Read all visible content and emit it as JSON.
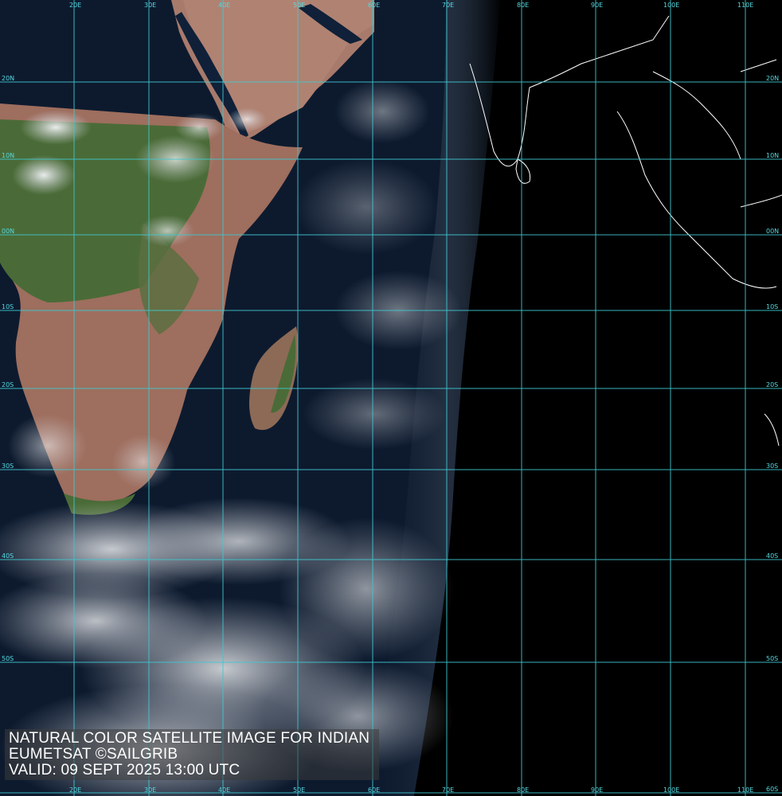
{
  "caption": {
    "line1": "NATURAL COLOR SATELLITE IMAGE FOR INDIAN",
    "line2": "EUMETSAT ©SAILGRIB",
    "line3": "VALID:  09 SEPT 2025 13:00 UTC"
  },
  "grid": {
    "lon_labels": [
      "20E",
      "30E",
      "40E",
      "50E",
      "60E",
      "70E",
      "80E",
      "90E",
      "100E",
      "110E"
    ],
    "lat_labels": [
      "20N",
      "10N",
      "00N",
      "10S",
      "20S",
      "30S",
      "40S",
      "50S",
      "60S"
    ],
    "line_color": "#3fc8d0"
  },
  "colors": {
    "ocean": "#0d1a2e",
    "night": "#000000",
    "land_desert": "#a8786a",
    "land_vegetation": "#4a6a36",
    "clouds": "#e6e8ec",
    "coastline_outline": "#ffffff"
  }
}
